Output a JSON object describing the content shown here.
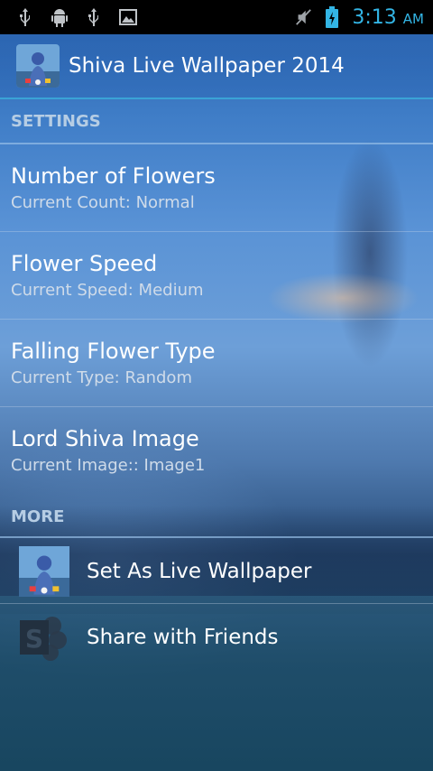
{
  "status_bar": {
    "time": "3:13",
    "ampm": "AM",
    "icons": [
      "usb-icon",
      "android-debug-icon",
      "usb-icon",
      "image-icon",
      "mute-icon",
      "battery-icon"
    ]
  },
  "action_bar": {
    "title": "Shiva Live Wallpaper 2014",
    "icon": "shiva-app-icon"
  },
  "settings": {
    "header": "SETTINGS",
    "items": [
      {
        "title": "Number of Flowers",
        "summary": "Current Count: Normal"
      },
      {
        "title": "Flower Speed",
        "summary": "Current Speed: Medium"
      },
      {
        "title": "Falling Flower Type",
        "summary": "Current Type: Random"
      },
      {
        "title": "Lord Shiva Image",
        "summary": "Current Image:: Image1"
      }
    ]
  },
  "more": {
    "header": "MORE",
    "items": [
      {
        "label": "Set As Live Wallpaper",
        "icon": "shiva-app-icon"
      },
      {
        "label": "Share with Friends",
        "icon": "sharepoint-icon"
      }
    ]
  },
  "colors": {
    "accent": "#33b5e5",
    "divider": "#3aa3d6"
  }
}
